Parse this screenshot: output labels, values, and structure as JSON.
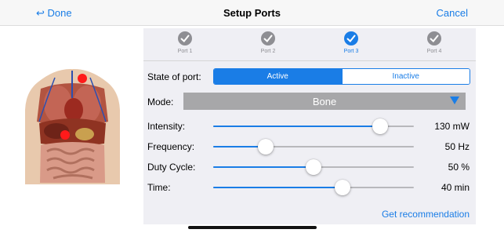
{
  "nav": {
    "done_label": "↩ Done",
    "title": "Setup Ports",
    "cancel_label": "Cancel"
  },
  "ports": [
    {
      "label": "Port 1",
      "state": "completed"
    },
    {
      "label": "Port 2",
      "state": "completed"
    },
    {
      "label": "Port 3",
      "state": "active"
    },
    {
      "label": "Port 4",
      "state": "completed"
    }
  ],
  "state_of_port": {
    "label": "State of port:",
    "options": [
      "Active",
      "Inactive"
    ],
    "selected": "Active"
  },
  "mode": {
    "label": "Mode:",
    "value": "Bone"
  },
  "sliders": [
    {
      "label": "Intensity:",
      "value_text": "130 mW",
      "fraction": 0.833
    },
    {
      "label": "Frequency:",
      "value_text": "50 Hz",
      "fraction": 0.262
    },
    {
      "label": "Duty Cycle:",
      "value_text": "50 %",
      "fraction": 0.5
    },
    {
      "label": "Time:",
      "value_text": "40 min",
      "fraction": 0.645
    }
  ],
  "recommendation_link": "Get recommendation",
  "colors": {
    "accent": "#1a7de6",
    "completed_step": "#8e8e93",
    "marker": "#ff1a1a"
  }
}
